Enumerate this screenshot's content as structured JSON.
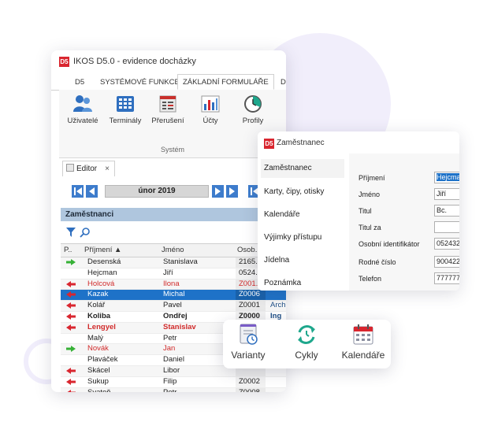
{
  "window": {
    "logo": "D5",
    "title": "IKOS D5.0 - evidence docházky"
  },
  "menu": [
    {
      "label": "D5",
      "active": false
    },
    {
      "label": "SYSTÉMOVÉ FUNKCE",
      "active": false
    },
    {
      "label": "ZÁKLADNÍ FORMULÁŘE",
      "active": true
    },
    {
      "label": "D",
      "active": false
    }
  ],
  "ribbon": {
    "buttons": [
      {
        "label": "Uživatelé",
        "icon": "users-icon"
      },
      {
        "label": "Terminály",
        "icon": "terminal-icon"
      },
      {
        "label": "Přerušení",
        "icon": "interruption-icon"
      },
      {
        "label": "Účty",
        "icon": "accounts-chart-icon"
      },
      {
        "label": "Profily",
        "icon": "profiles-clock-icon"
      }
    ],
    "group_label": "Systém"
  },
  "editor_tab": {
    "label": "Editor",
    "close": "×"
  },
  "month_nav": {
    "label": "únor 2019"
  },
  "section": {
    "title": "Zaměstnanci"
  },
  "grid": {
    "headers": {
      "icon": "P..",
      "surname": "Příjmení ▲",
      "name": "Jméno",
      "id": "Osob..."
    },
    "rows": [
      {
        "arrow": "in",
        "surname": "Desenská",
        "name": "Stanislava",
        "id": "2165...",
        "extra": "",
        "style": ""
      },
      {
        "arrow": "",
        "surname": "Hejcman",
        "name": "Jiří",
        "id": "0524...",
        "extra": "",
        "style": ""
      },
      {
        "arrow": "out",
        "surname": "Holcová",
        "name": "Ilona",
        "id": "Z001...",
        "extra": "",
        "style": "red"
      },
      {
        "arrow": "out",
        "surname": "Kazak",
        "name": "Michal",
        "id": "Z0006",
        "extra": "",
        "style": "sel"
      },
      {
        "arrow": "out",
        "surname": "Kolář",
        "name": "Pavel",
        "id": "Z0001",
        "extra": "Arch",
        "style": ""
      },
      {
        "arrow": "out",
        "surname": "Koliba",
        "name": "Ondřej",
        "id": "Z0000",
        "extra": "Ing",
        "style": "bold"
      },
      {
        "arrow": "out",
        "surname": "Lengyel",
        "name": "Stanislav",
        "id": "",
        "extra": "",
        "style": "red bold"
      },
      {
        "arrow": "",
        "surname": "Malý",
        "name": "Petr",
        "id": "",
        "extra": "",
        "style": ""
      },
      {
        "arrow": "in",
        "surname": "Novák",
        "name": "Jan",
        "id": "",
        "extra": "",
        "style": "red"
      },
      {
        "arrow": "",
        "surname": "Plaváček",
        "name": "Daniel",
        "id": "",
        "extra": "",
        "style": ""
      },
      {
        "arrow": "out",
        "surname": "Skácel",
        "name": "Libor",
        "id": "",
        "extra": "",
        "style": ""
      },
      {
        "arrow": "out",
        "surname": "Sukup",
        "name": "Filip",
        "id": "Z0002",
        "extra": "",
        "style": ""
      },
      {
        "arrow": "out",
        "surname": "Svatoň",
        "name": "Petr",
        "id": "Z0008",
        "extra": "",
        "style": ""
      }
    ]
  },
  "employee_window": {
    "logo": "D5",
    "title": "Zaměstnanec",
    "nav": [
      "Zaměstnanec",
      "Karty, čipy, otisky",
      "Kalendáře",
      "Výjimky přístupu",
      "Jídelna",
      "Poznámka"
    ],
    "fields": [
      {
        "label": "Příjmení",
        "value": "Hejcman"
      },
      {
        "label": "Jméno",
        "value": "Jiří"
      },
      {
        "label": "Titul",
        "value": "Bc."
      },
      {
        "label": "Titul za",
        "value": ""
      },
      {
        "label": "Osobní identifikátor",
        "value": "052432"
      },
      {
        "label": "Rodné číslo",
        "value": "900422/"
      },
      {
        "label": "Telefon",
        "value": "777777"
      }
    ]
  },
  "floating_toolbar": [
    {
      "label": "Varianty",
      "icon": "variants-icon"
    },
    {
      "label": "Cykly",
      "icon": "cycles-icon"
    },
    {
      "label": "Kalendáře",
      "icon": "calendar-icon"
    }
  ],
  "colors": {
    "accent_blue": "#1e72c8",
    "logo_red": "#d9262f",
    "teal": "#1ea78c",
    "purple": "#7a5cc7",
    "red_text": "#d12b2b"
  }
}
